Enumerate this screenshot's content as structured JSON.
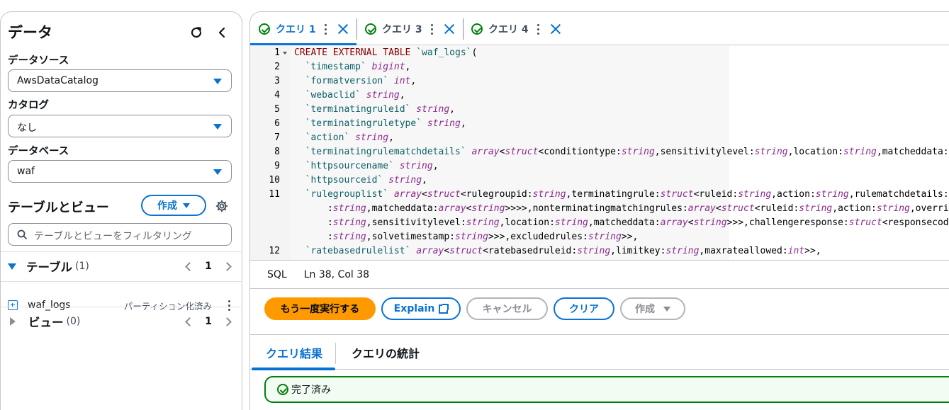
{
  "sidebar": {
    "title": "データ",
    "data_source_label": "データソース",
    "data_source_value": "AwsDataCatalog",
    "catalog_label": "カタログ",
    "catalog_value": "なし",
    "database_label": "データベース",
    "database_value": "waf",
    "tables_views_title": "テーブルとビュー",
    "create_label": "作成",
    "filter_placeholder": "テーブルとビューをフィルタリング",
    "tables_section": {
      "label": "テーブル",
      "count": "(1)",
      "page": "1"
    },
    "views_section": {
      "label": "ビュー",
      "count": "(0)",
      "page": "1"
    },
    "tables": [
      {
        "name": "waf_logs",
        "badge": "パーティション化済み"
      }
    ]
  },
  "query_tabs": [
    {
      "label": "クエリ 1",
      "active": true
    },
    {
      "label": "クエリ 3",
      "active": false
    },
    {
      "label": "クエリ 4",
      "active": false
    }
  ],
  "editor": {
    "language": "SQL",
    "cursor_position": "Ln 38, Col 38",
    "lines": [
      {
        "num": "1",
        "fold": true,
        "text": "CREATE EXTERNAL TABLE `waf_logs`("
      },
      {
        "num": "2",
        "text": "  `timestamp` bigint,"
      },
      {
        "num": "3",
        "text": "  `formatversion` int,"
      },
      {
        "num": "4",
        "text": "  `webaclid` string,"
      },
      {
        "num": "5",
        "text": "  `terminatingruleid` string,"
      },
      {
        "num": "6",
        "text": "  `terminatingruletype` string,"
      },
      {
        "num": "7",
        "text": "  `action` string,"
      },
      {
        "num": "8",
        "text": "  `terminatingrulematchdetails` array<struct<conditiontype:string,sensitivitylevel:string,location:string,matcheddata:array<string>>>,"
      },
      {
        "num": "9",
        "text": "  `httpsourcename` string,"
      },
      {
        "num": "10",
        "text": "  `httpsourceid` string,"
      },
      {
        "num": "11",
        "text": "  `rulegrouplist` array<struct<rulegroupid:string,terminatingrule:struct<ruleid:string,action:string,rulematchdetails:array<struct<conditiontype:string,location"
      },
      {
        "num": "",
        "text": "      :string,matcheddata:array<string>>>>,nonterminatingmatchingrules:array<struct<ruleid:string,action:string,overriddenaction:string,rulematchdetails"
      },
      {
        "num": "",
        "text": "      :string,sensitivitylevel:string,location:string,matcheddata:array<string>>>,challengeresponse:struct<responsecode:string,solvetimestamp:string>,captcharesponse"
      },
      {
        "num": "",
        "text": "      :string,solvetimestamp:string>>>,excludedrules:string>>,"
      },
      {
        "num": "12",
        "text": "  `ratebasedrulelist` array<struct<ratebasedruleid:string,limitkey:string,maxrateallowed:int>>,"
      }
    ]
  },
  "actions": {
    "run_again": "もう一度実行する",
    "explain": "Explain",
    "cancel": "キャンセル",
    "clear": "クリア",
    "create": "作成"
  },
  "result_tabs": {
    "results": "クエリ結果",
    "stats": "クエリの統計"
  },
  "status": {
    "text": "完了済み"
  },
  "colors": {
    "accent": "#0972d3",
    "primary_button": "#ff9900",
    "success": "#037f0c"
  }
}
